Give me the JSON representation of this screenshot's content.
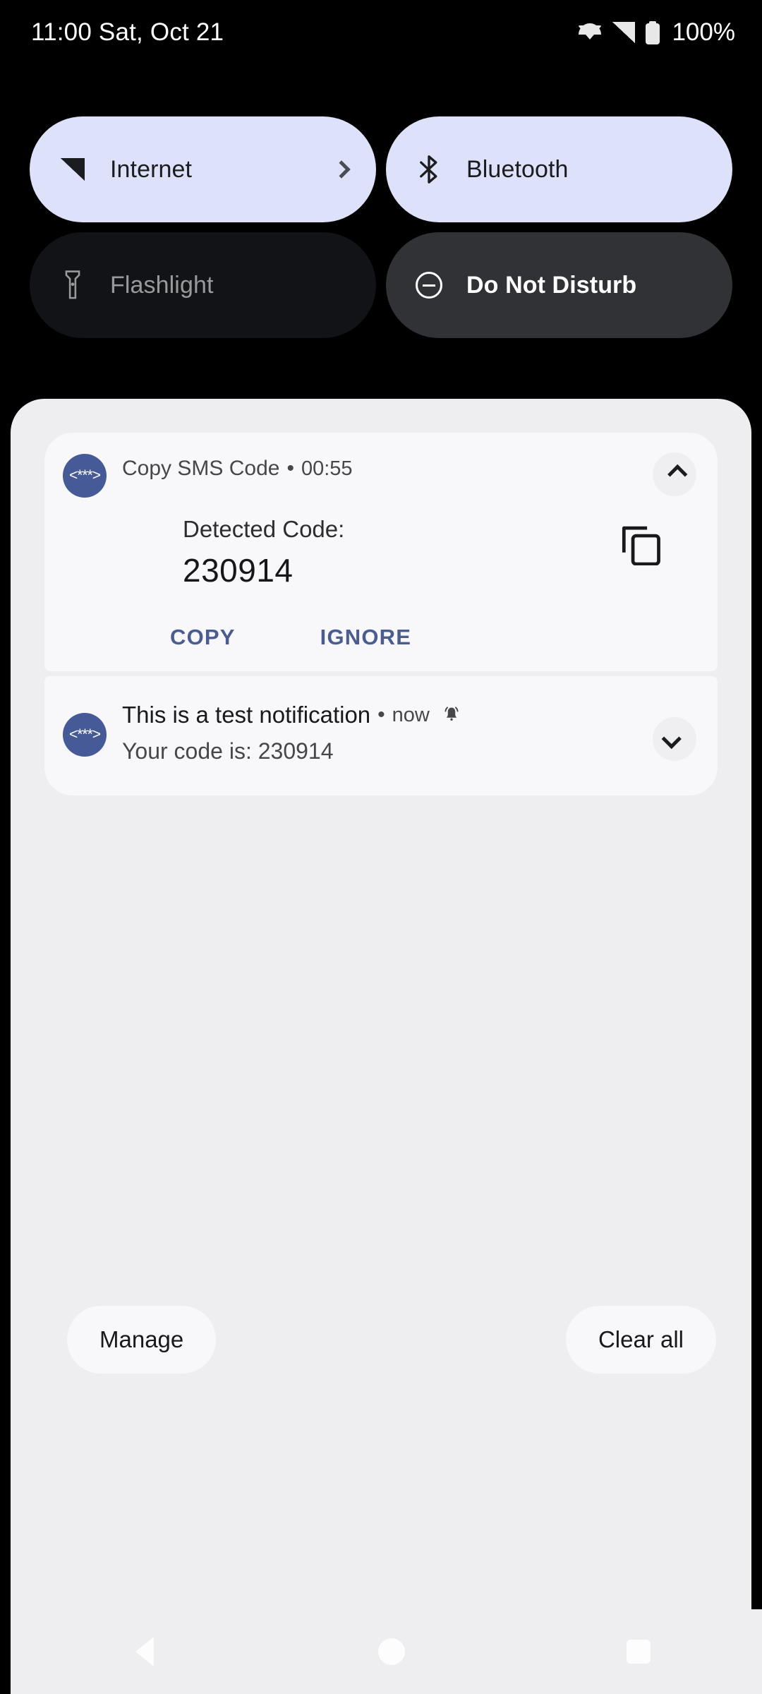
{
  "status_bar": {
    "clock": "11:00 Sat, Oct 21",
    "battery_percent": "100%",
    "icons": [
      "wifi-icon",
      "cellular-signal-icon",
      "battery-icon"
    ]
  },
  "quick_settings": {
    "tiles": [
      {
        "label": "Internet",
        "icon": "signal-triangle-icon",
        "state": "active",
        "has_chevron": true
      },
      {
        "label": "Bluetooth",
        "icon": "bluetooth-icon",
        "state": "active",
        "has_chevron": false
      },
      {
        "label": "Flashlight",
        "icon": "flashlight-icon",
        "state": "inactive-dark",
        "has_chevron": false
      },
      {
        "label": "Do Not Disturb",
        "icon": "circle-minus-icon",
        "state": "inactive-gray",
        "has_chevron": false
      }
    ]
  },
  "notifications": [
    {
      "app_name": "Copy SMS Code",
      "separator": "•",
      "time": "00:55",
      "app_icon": "sms-code-app-icon",
      "app_icon_glyph": "<***>",
      "app_icon_color": "#455a96",
      "expand_state": "chevron-up-icon",
      "detected_label": "Detected Code:",
      "detected_code": "230914",
      "copy_icon": "copy-icon",
      "actions": [
        "COPY",
        "IGNORE"
      ],
      "action_color": "#4b5c8e"
    },
    {
      "title": "This is a test notification",
      "separator": "•",
      "time": "now",
      "alert_icon": "bell-icon",
      "app_icon": "sms-code-app-icon",
      "app_icon_glyph": "<***>",
      "body": "Your code is: 230914",
      "expand_state": "chevron-down-icon"
    }
  ],
  "footer": {
    "manage_label": "Manage",
    "clear_all_label": "Clear all"
  },
  "nav_bar": {
    "back": "back-triangle-icon",
    "home": "home-circle-icon",
    "recents": "recents-square-icon"
  },
  "colors": {
    "background": "#000000",
    "tile_active": "#dde1f9",
    "tile_inactive_dark": "#121316",
    "tile_inactive_gray": "#313235",
    "shade_background": "#eeeef1",
    "card_background": "#f8f8fb",
    "accent_blue": "#4b5c8e"
  }
}
